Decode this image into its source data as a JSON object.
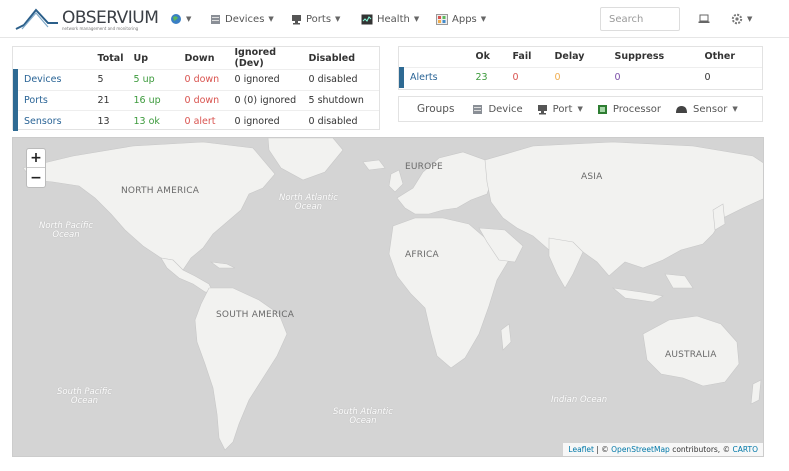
{
  "brand": {
    "name": "OBSERVIUM",
    "tagline": "network management and monitoring"
  },
  "nav": {
    "devices": "Devices",
    "ports": "Ports",
    "health": "Health",
    "apps": "Apps",
    "search_placeholder": "Search"
  },
  "summary": {
    "headers": [
      "",
      "Total",
      "Up",
      "Down",
      "Ignored (Dev)",
      "Disabled"
    ],
    "rows": [
      {
        "name": "Devices",
        "total": "5",
        "up": "5 up",
        "down": "0 down",
        "ignored": "0 ignored",
        "disabled": "0 disabled"
      },
      {
        "name": "Ports",
        "total": "21",
        "up": "16 up",
        "down": "0 down",
        "ignored": "0 (0) ignored",
        "disabled": "5 shutdown"
      },
      {
        "name": "Sensors",
        "total": "13",
        "up": "13 ok",
        "down": "0 alert",
        "ignored": "0 ignored",
        "disabled": "0 disabled"
      }
    ]
  },
  "alerts": {
    "headers": [
      "",
      "Ok",
      "Fail",
      "Delay",
      "Suppress",
      "Other"
    ],
    "row": {
      "name": "Alerts",
      "ok": "23",
      "fail": "0",
      "delay": "0",
      "suppress": "0",
      "other": "0"
    }
  },
  "groups": {
    "label": "Groups",
    "device": "Device",
    "port": "Port",
    "processor": "Processor",
    "sensor": "Sensor"
  },
  "map": {
    "continents": {
      "north_america": "NORTH AMERICA",
      "south_america": "SOUTH AMERICA",
      "europe": "EUROPE",
      "africa": "AFRICA",
      "asia": "ASIA",
      "australia": "AUSTRALIA"
    },
    "oceans": {
      "north_atlantic": "North Atlantic\nOcean",
      "north_pacific": "North Pacific\nOcean",
      "south_pacific": "South Pacific\nOcean",
      "south_atlantic": "South Atlantic\nOcean",
      "indian": "Indian Ocean"
    },
    "zoom_in": "+",
    "zoom_out": "−",
    "attribution": {
      "leaflet": "Leaflet",
      "sep1": " | © ",
      "osm": "OpenStreetMap",
      "mid": " contributors, © ",
      "carto": "CARTO"
    }
  }
}
